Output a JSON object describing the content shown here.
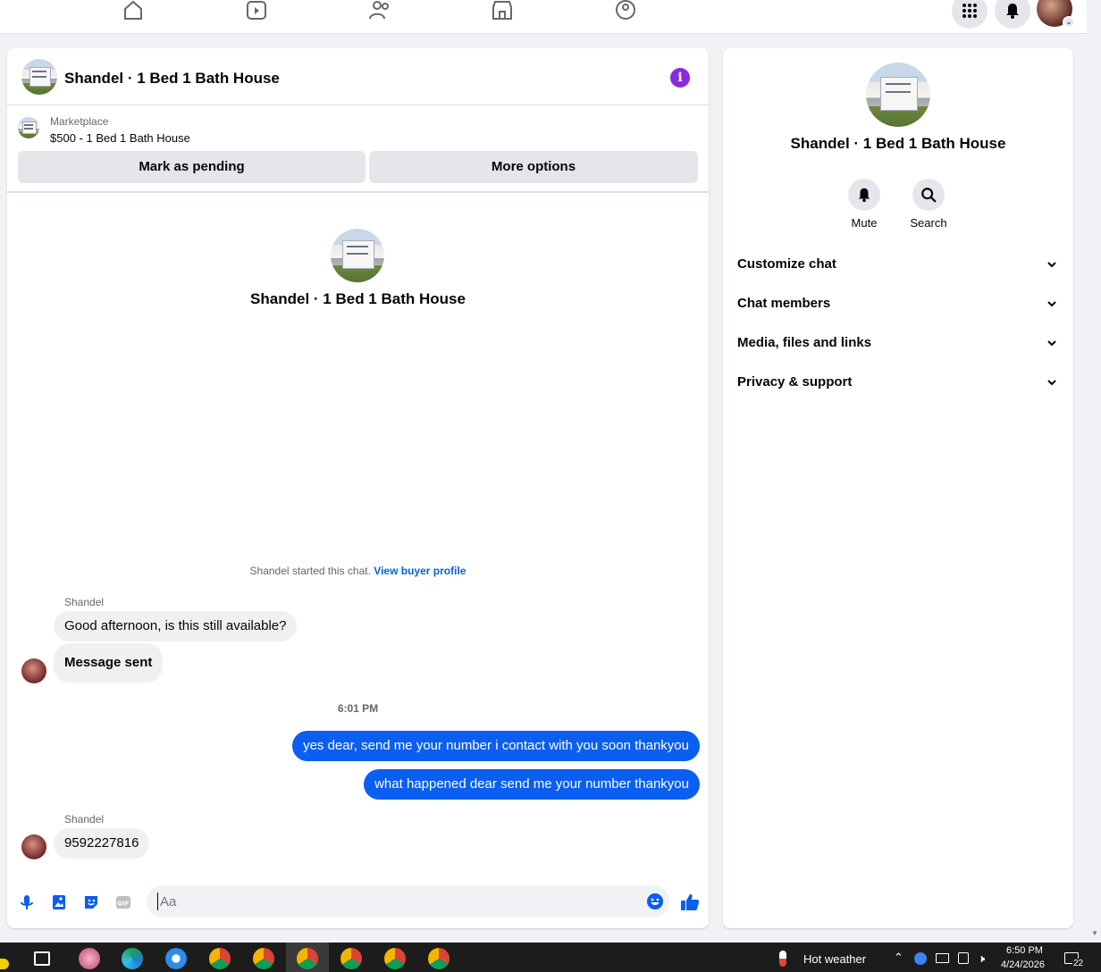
{
  "topnav": {
    "icons": [
      "home-icon",
      "video-icon",
      "friends-icon",
      "marketplace-icon",
      "groups-icon"
    ],
    "menu_icon": "grid-menu-icon",
    "notifications_icon": "bell-icon"
  },
  "chat": {
    "header_title": "Shandel · 1 Bed 1 Bath House",
    "listing": {
      "label": "Marketplace",
      "price_title": "$500 - 1 Bed 1 Bath House"
    },
    "buttons": {
      "mark_pending": "Mark as pending",
      "more_options": "More options"
    },
    "intro_title": "Shandel · 1 Bed 1 Bath House",
    "started_text": "Shandel started this chat.",
    "view_buyer_profile": "View buyer profile",
    "messages": [
      {
        "sender": "Shandel",
        "text": "Good afternoon, is this still available?",
        "direction": "in"
      },
      {
        "text": "Message sent",
        "direction": "in"
      },
      {
        "timestamp": "6:01 PM"
      },
      {
        "text": "yes dear, send me your number i contact with you soon thankyou",
        "direction": "out"
      },
      {
        "text": "what happened dear send me your number thankyou",
        "direction": "out"
      },
      {
        "sender": "Shandel",
        "text": "9592227816",
        "direction": "in"
      }
    ],
    "composer": {
      "placeholder": "Aa"
    }
  },
  "side": {
    "title": "Shandel · 1 Bed 1 Bath House",
    "actions": [
      {
        "label": "Mute",
        "icon": "bell-icon"
      },
      {
        "label": "Search",
        "icon": "search-icon"
      }
    ],
    "sections": [
      "Customize chat",
      "Chat members",
      "Media, files and links",
      "Privacy & support"
    ]
  },
  "taskbar": {
    "weather": "Hot weather",
    "time": "6:50 PM",
    "date": "4/24/2026",
    "notification_count": "22"
  },
  "colors": {
    "messenger_blue": "#0a5ef0",
    "link_blue": "#0064d1",
    "info_purple": "#8a2be2"
  }
}
